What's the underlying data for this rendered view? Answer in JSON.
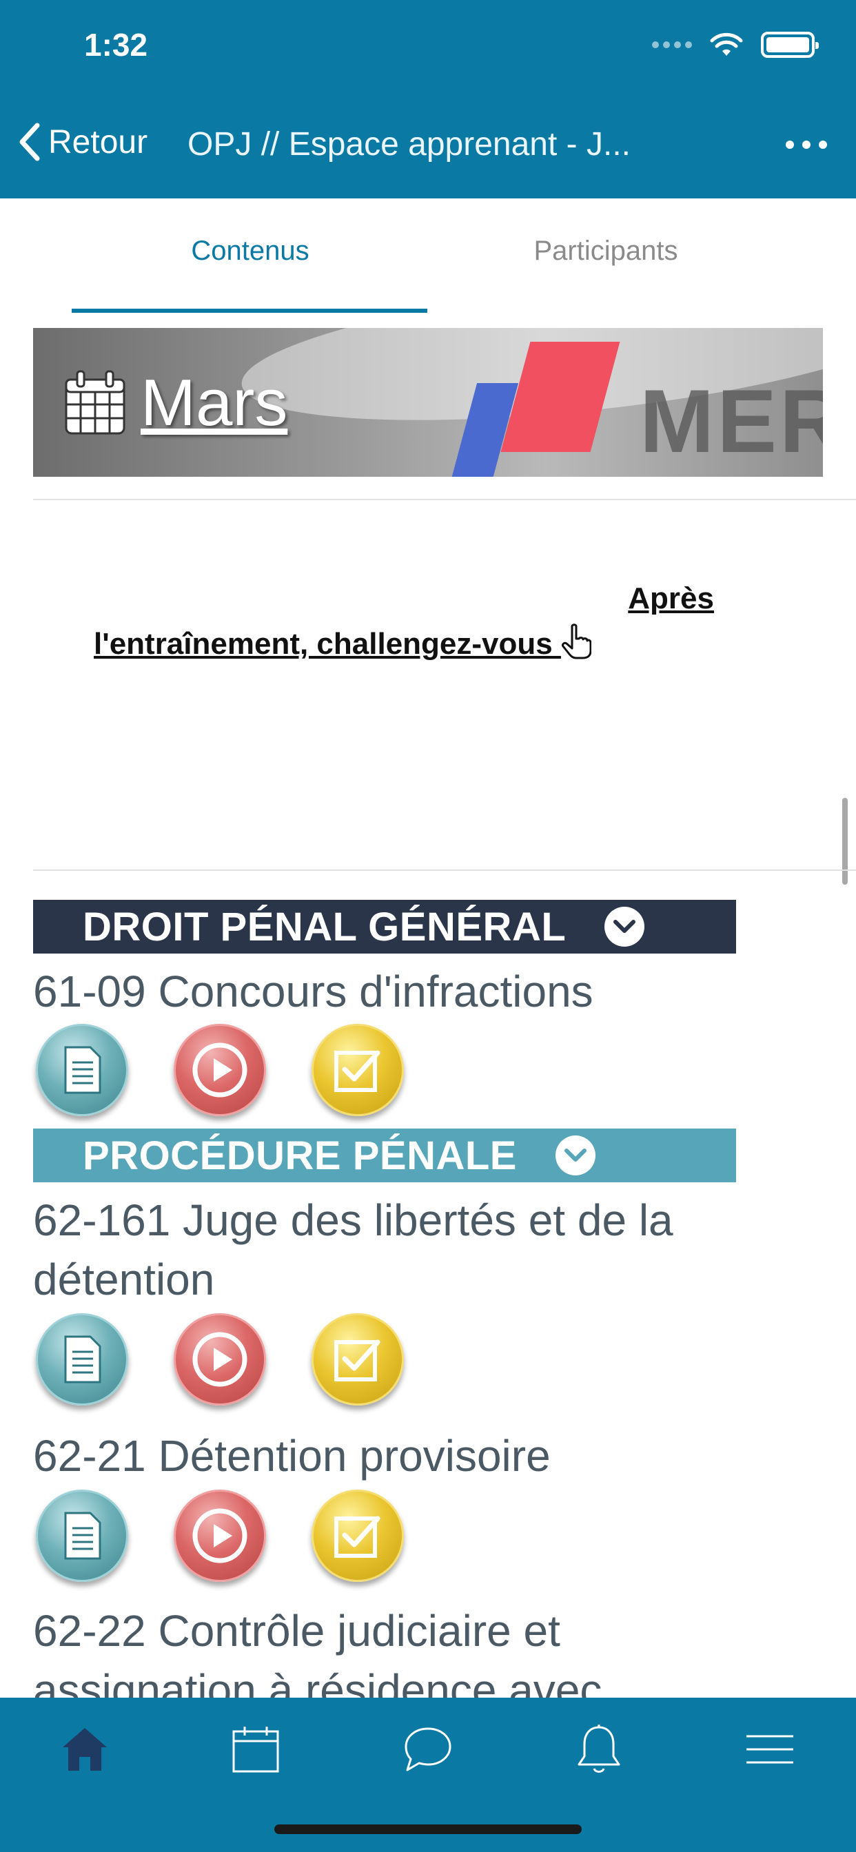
{
  "status_bar": {
    "time": "1:32"
  },
  "nav": {
    "back_label": "Retour",
    "title": "OPJ // Espace apprenant - J..."
  },
  "tabs": [
    {
      "label": "Contenus",
      "active": true
    },
    {
      "label": "Participants",
      "active": false
    }
  ],
  "banner": {
    "label": "Mars",
    "icon": "calendar-icon"
  },
  "challenge": {
    "line1": "Après",
    "line2": "l'entraînement, challengez-vous "
  },
  "sections": [
    {
      "title": "DROIT PÉNAL GÉNÉRAL",
      "color": "#2a3549",
      "items": [
        {
          "title": "61-09   Concours d'infractions"
        }
      ]
    },
    {
      "title": "PROCÉDURE PÉNALE",
      "color": "#56a5b8",
      "items": [
        {
          "title": "62-161  Juge des libertés et de la détention"
        },
        {
          "title": "62-21   Détention provisoire"
        },
        {
          "title": "62-22  Contrôle judiciaire et assignation à résidence avec"
        }
      ]
    }
  ],
  "item_actions": [
    "document-icon",
    "play-icon",
    "checkbox-icon"
  ],
  "tabbar": [
    "home-icon",
    "calendar-icon",
    "chat-icon",
    "bell-icon",
    "menu-icon"
  ],
  "colors": {
    "primary": "#0a7aa4",
    "active_tab_icon": "#1f3b63"
  }
}
